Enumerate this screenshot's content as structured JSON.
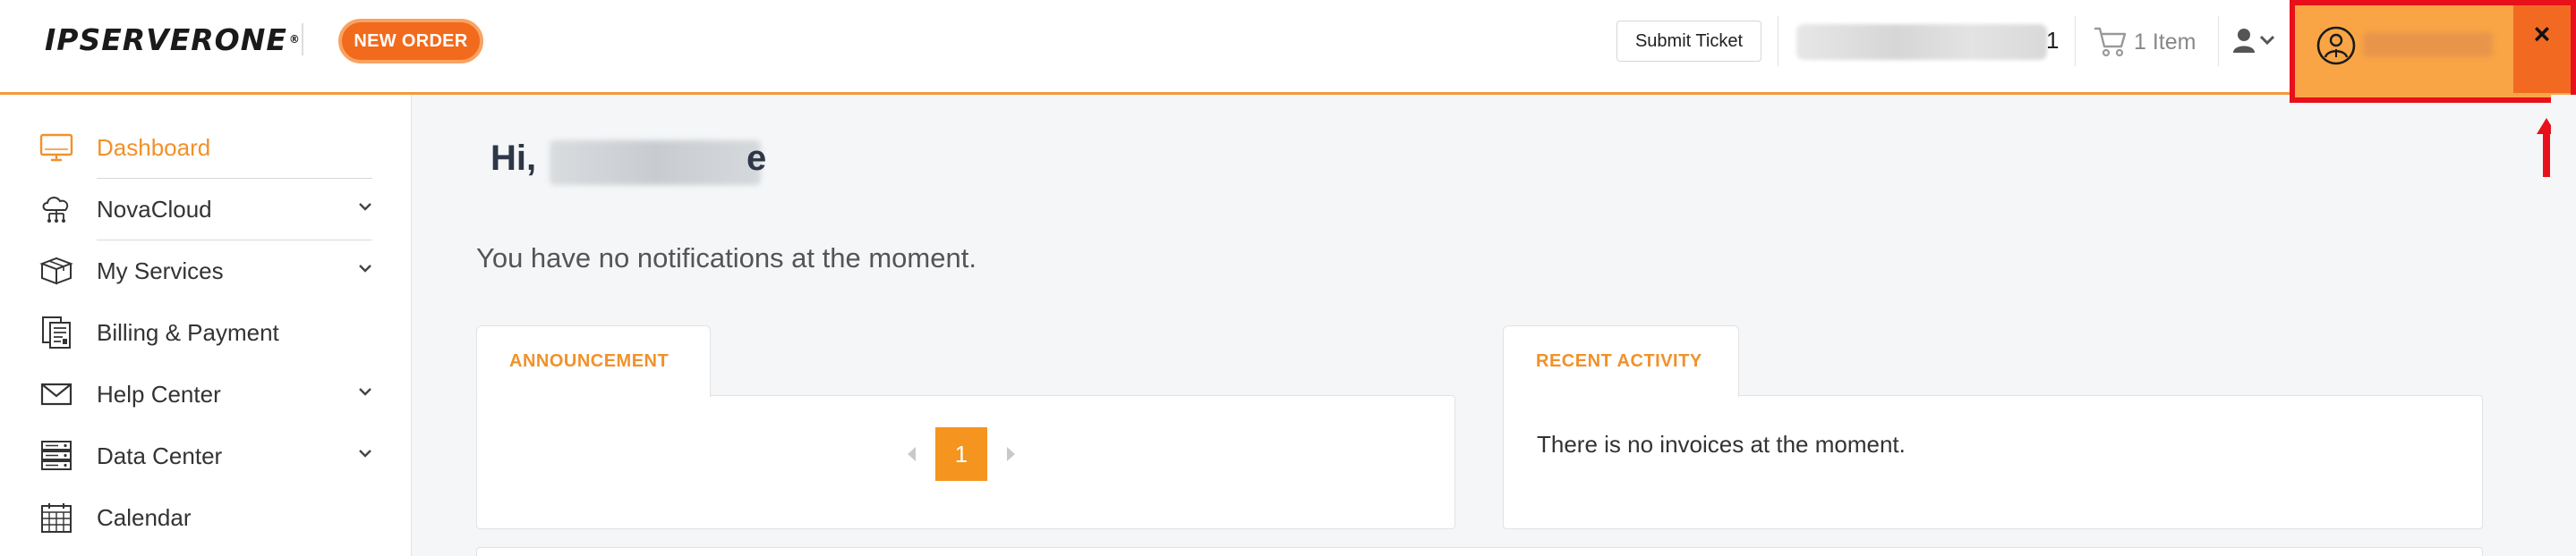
{
  "header": {
    "logo_text": "IPSERVERONE",
    "new_order_label": "NEW ORDER",
    "submit_ticket_label": "Submit Ticket",
    "account_suffix": "1",
    "cart_label": "1 Item",
    "close_label": "×"
  },
  "sidebar": {
    "items": [
      {
        "label": "Dashboard",
        "icon": "monitor-icon",
        "active": true,
        "has_submenu": false
      },
      {
        "label": "NovaCloud",
        "icon": "cloud-network-icon",
        "active": false,
        "has_submenu": true
      },
      {
        "label": "My Services",
        "icon": "box-icon",
        "active": false,
        "has_submenu": true
      },
      {
        "label": "Billing & Payment",
        "icon": "invoice-icon",
        "active": false,
        "has_submenu": false
      },
      {
        "label": "Help Center",
        "icon": "envelope-icon",
        "active": false,
        "has_submenu": true
      },
      {
        "label": "Data Center",
        "icon": "server-rack-icon",
        "active": false,
        "has_submenu": true
      },
      {
        "label": "Calendar",
        "icon": "calendar-icon",
        "active": false,
        "has_submenu": false
      }
    ]
  },
  "main": {
    "greeting_prefix": "Hi,",
    "greeting_tail": "e",
    "no_notifications": "You have no notifications at the moment.",
    "announcement_tab": "ANNOUNCEMENT",
    "recent_activity_tab": "RECENT ACTIVITY",
    "current_page": "1",
    "activity_empty": "There is no invoices at the moment."
  },
  "colors": {
    "brand_orange": "#f26a1b",
    "accent_orange": "#f1912a",
    "highlight_red": "#e8101a",
    "page_btn": "#f5951f"
  }
}
